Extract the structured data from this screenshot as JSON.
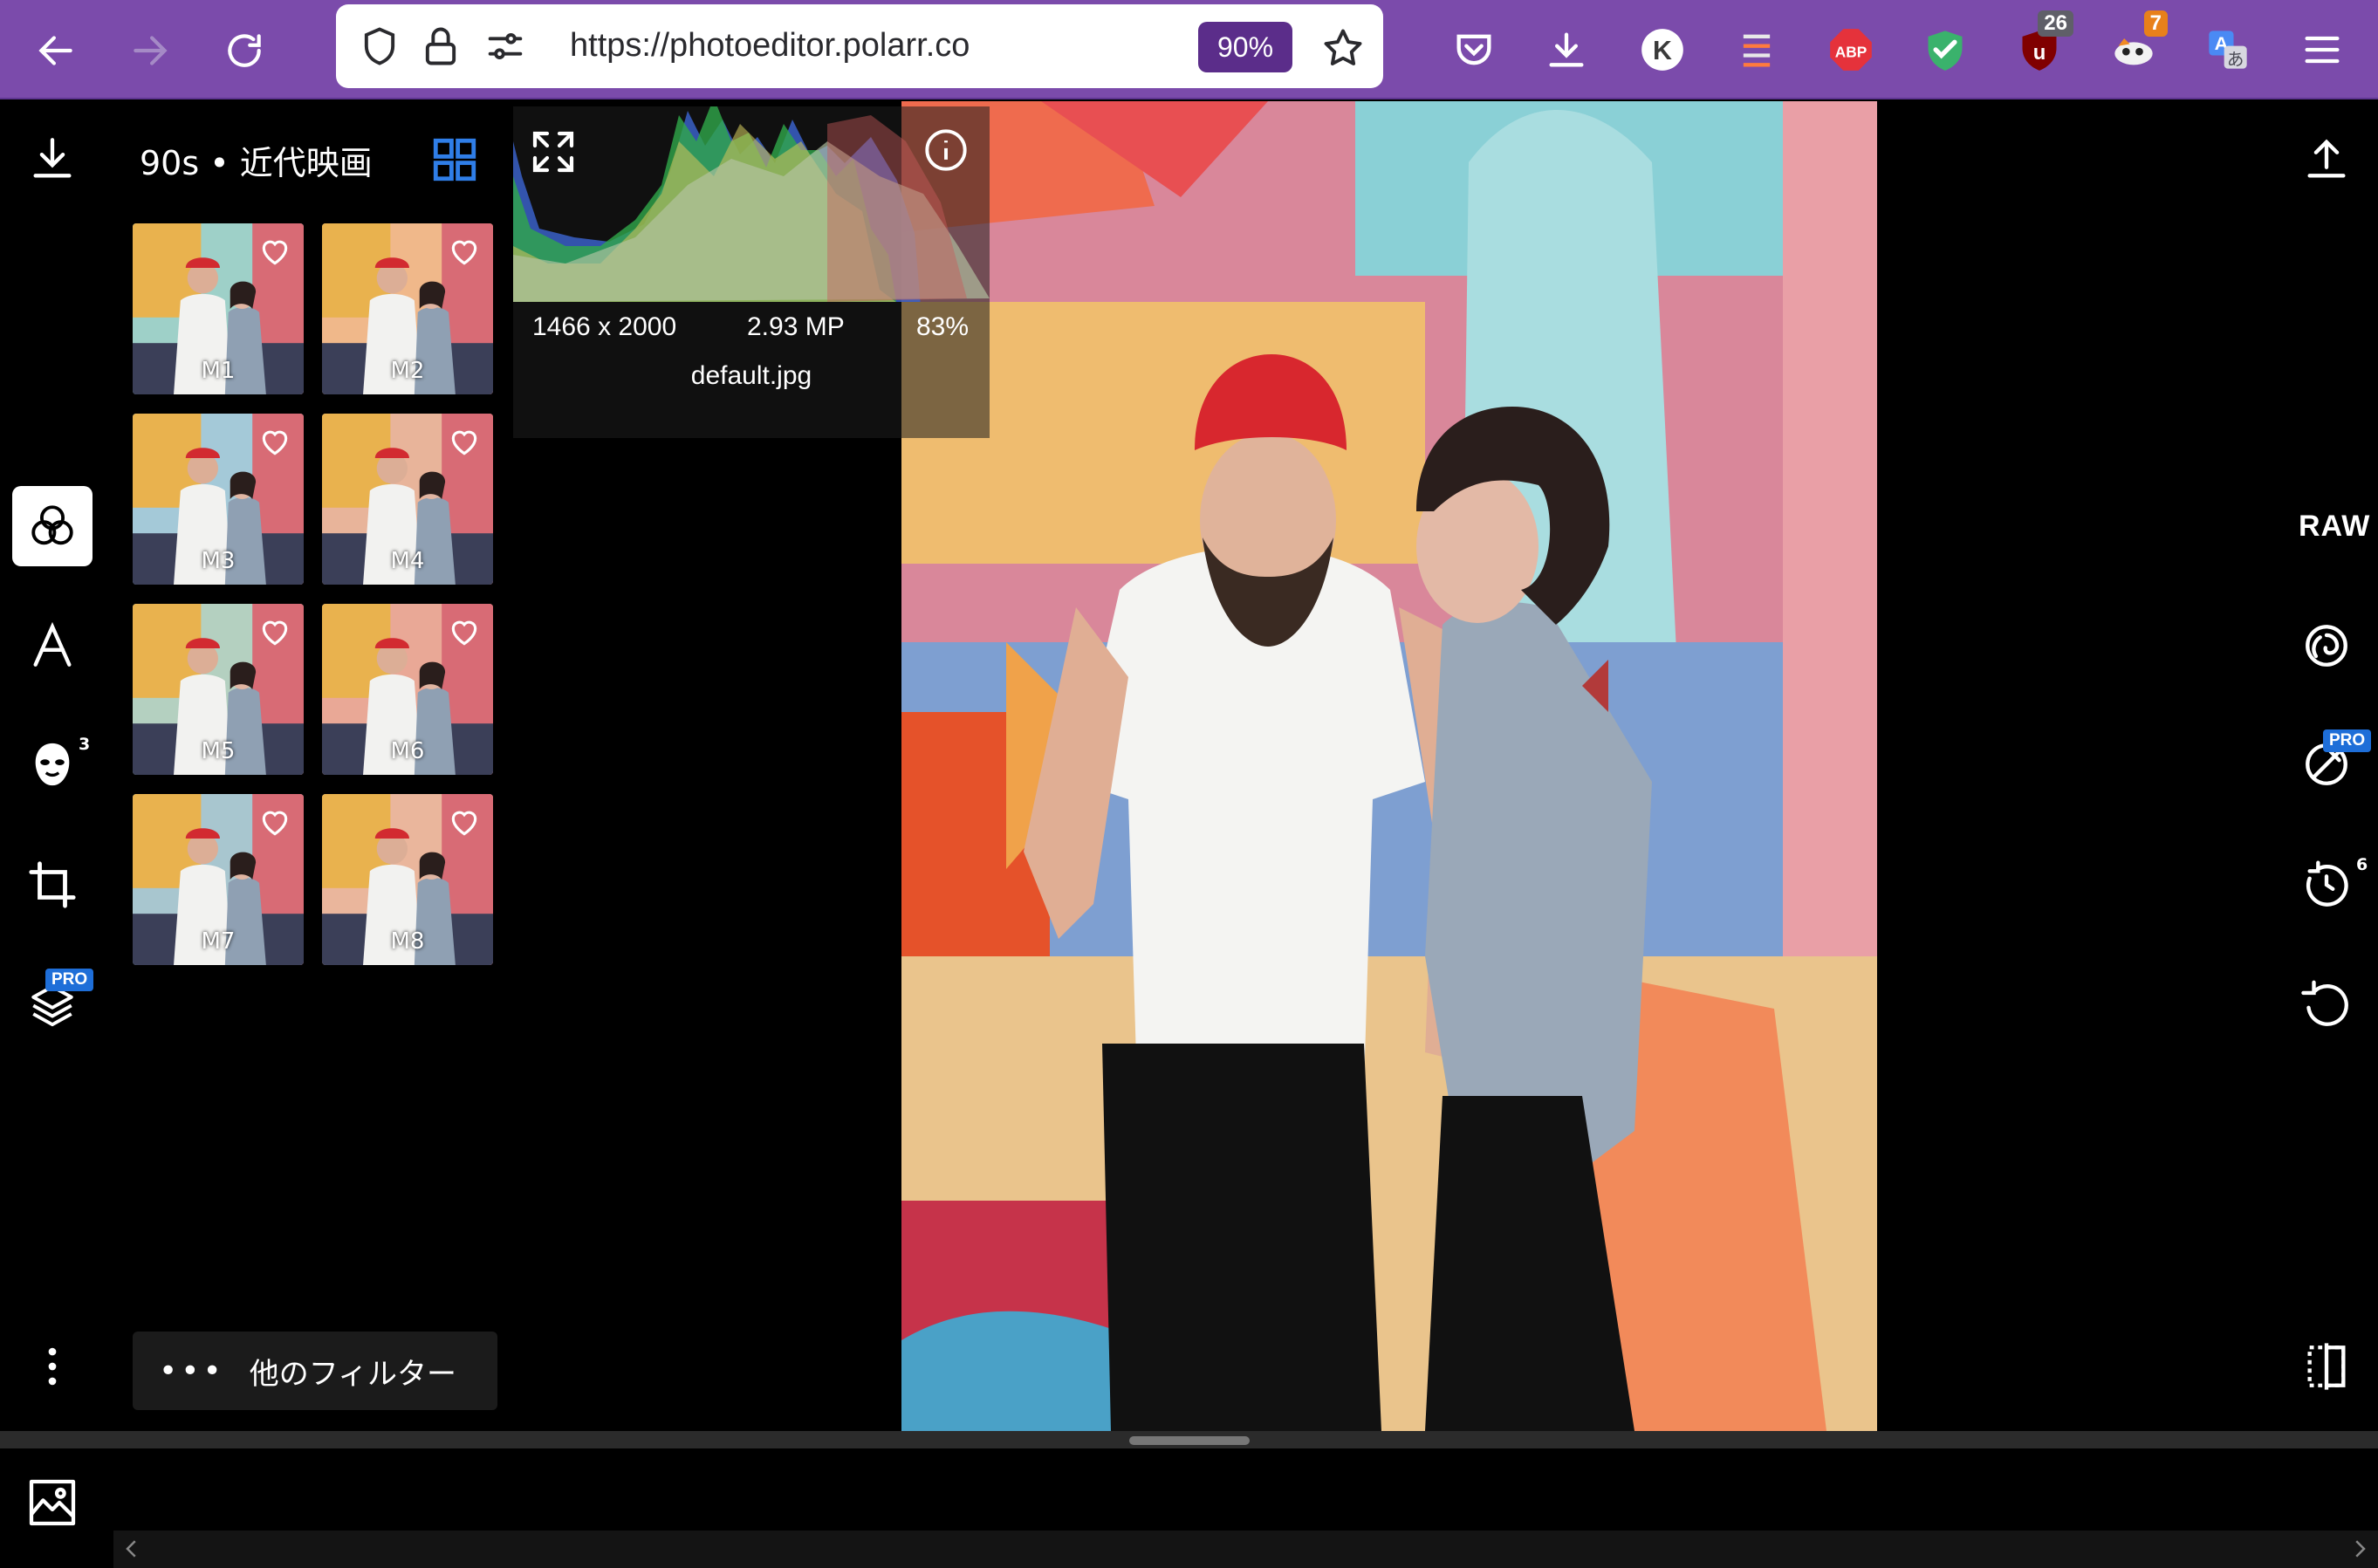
{
  "browser": {
    "url": "https://photoeditor.polarr.co",
    "zoom": "90%",
    "extensions": [
      {
        "name": "pocket-icon"
      },
      {
        "name": "download-icon"
      },
      {
        "name": "k-extension-icon",
        "label": "K"
      },
      {
        "name": "list-extension-icon"
      },
      {
        "name": "adblock-plus-icon",
        "label": "ABP"
      },
      {
        "name": "shield-check-icon"
      },
      {
        "name": "ublock-icon",
        "badge": "26"
      },
      {
        "name": "extension-animal-icon",
        "badge": "7"
      },
      {
        "name": "translate-icon"
      },
      {
        "name": "menu-icon"
      }
    ]
  },
  "editor": {
    "preset_title": "90s • 近代映画",
    "presets": [
      {
        "label": "M1"
      },
      {
        "label": "M2"
      },
      {
        "label": "M3"
      },
      {
        "label": "M4"
      },
      {
        "label": "M5"
      },
      {
        "label": "M6"
      },
      {
        "label": "M7"
      },
      {
        "label": "M8"
      }
    ],
    "more_filters": "他のフィルター",
    "face_count": "3",
    "history_count": "6",
    "pro": "PRO",
    "raw": "RAW",
    "histogram": {
      "dimensions": "1466 x 2000",
      "megapixels": "2.93 MP",
      "zoom": "83%",
      "filename": "default.jpg"
    }
  },
  "colors": {
    "browser_bar": "#7b4bab",
    "zoom_badge": "#5b2d8a",
    "accent_blue": "#1e6ed8",
    "panel_bg": "#000000"
  }
}
